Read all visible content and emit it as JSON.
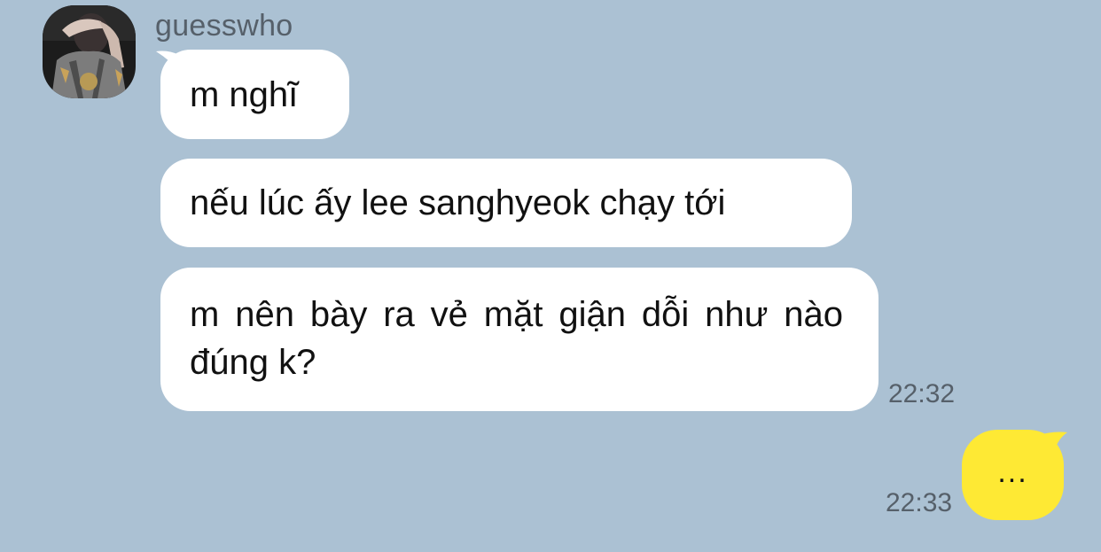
{
  "sender": {
    "name": "guesswho",
    "avatar_icon": "profile-photo-icon"
  },
  "received": [
    {
      "text": "m nghĩ"
    },
    {
      "text": "nếu lúc ấy lee sanghyeok chạy tới"
    },
    {
      "text": "m nên bày ra vẻ mặt giận dỗi như nào đúng k?"
    }
  ],
  "received_time": "22:32",
  "sent": {
    "text": "...",
    "time": "22:33"
  },
  "colors": {
    "background": "#abc1d3",
    "received_bubble": "#ffffff",
    "sent_bubble": "#fee934",
    "meta_text": "#56606a"
  }
}
